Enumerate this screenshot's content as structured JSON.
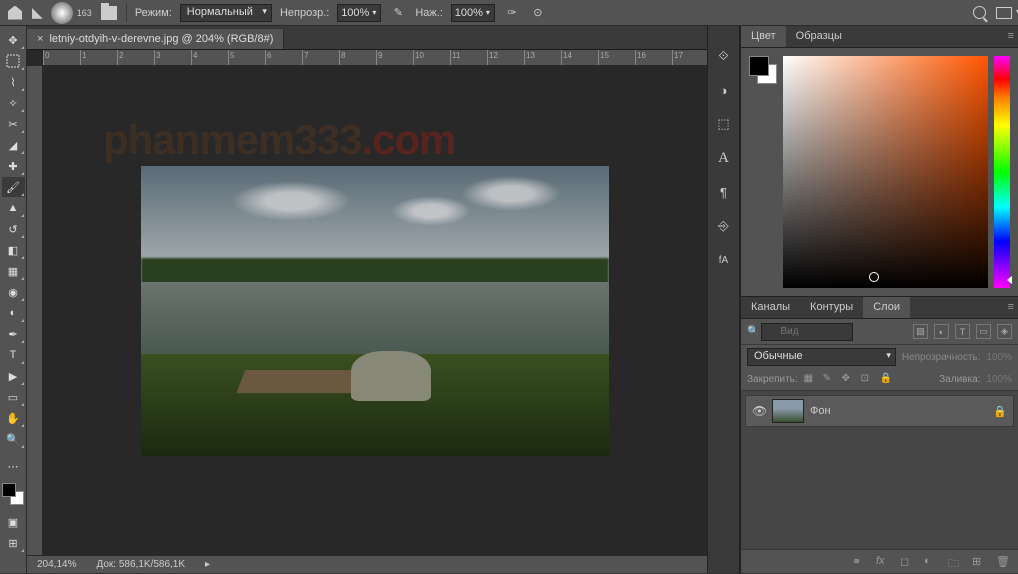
{
  "topbar": {
    "brush_size": "163",
    "mode_label": "Режим:",
    "mode_value": "Нормальный",
    "opacity_label": "Непрозр.:",
    "opacity_value": "100%",
    "flow_label": "Наж.:",
    "flow_value": "100%"
  },
  "document": {
    "tab_title": "letniy-otdyih-v-derevne.jpg @ 204% (RGB/8#)"
  },
  "ruler_marks": [
    "0",
    "1",
    "2",
    "3",
    "4",
    "5",
    "6",
    "7",
    "8",
    "9",
    "10",
    "11",
    "12",
    "13",
    "14",
    "15",
    "16",
    "17"
  ],
  "watermark": {
    "part1": "phanmem333",
    "part2": ".com"
  },
  "statusbar": {
    "zoom": "204,14%",
    "doc_info": "Док: 586,1K/586,1K"
  },
  "panels": {
    "color_tab": "Цвет",
    "swatches_tab": "Образцы",
    "channels_tab": "Каналы",
    "paths_tab": "Контуры",
    "layers_tab": "Слои"
  },
  "layers": {
    "search_placeholder": "Вид",
    "blend_mode": "Обычные",
    "opacity_label": "Непрозрачность:",
    "opacity_value": "100%",
    "lock_label": "Закрепить:",
    "fill_label": "Заливка:",
    "fill_value": "100%",
    "layer_name": "Фон"
  }
}
